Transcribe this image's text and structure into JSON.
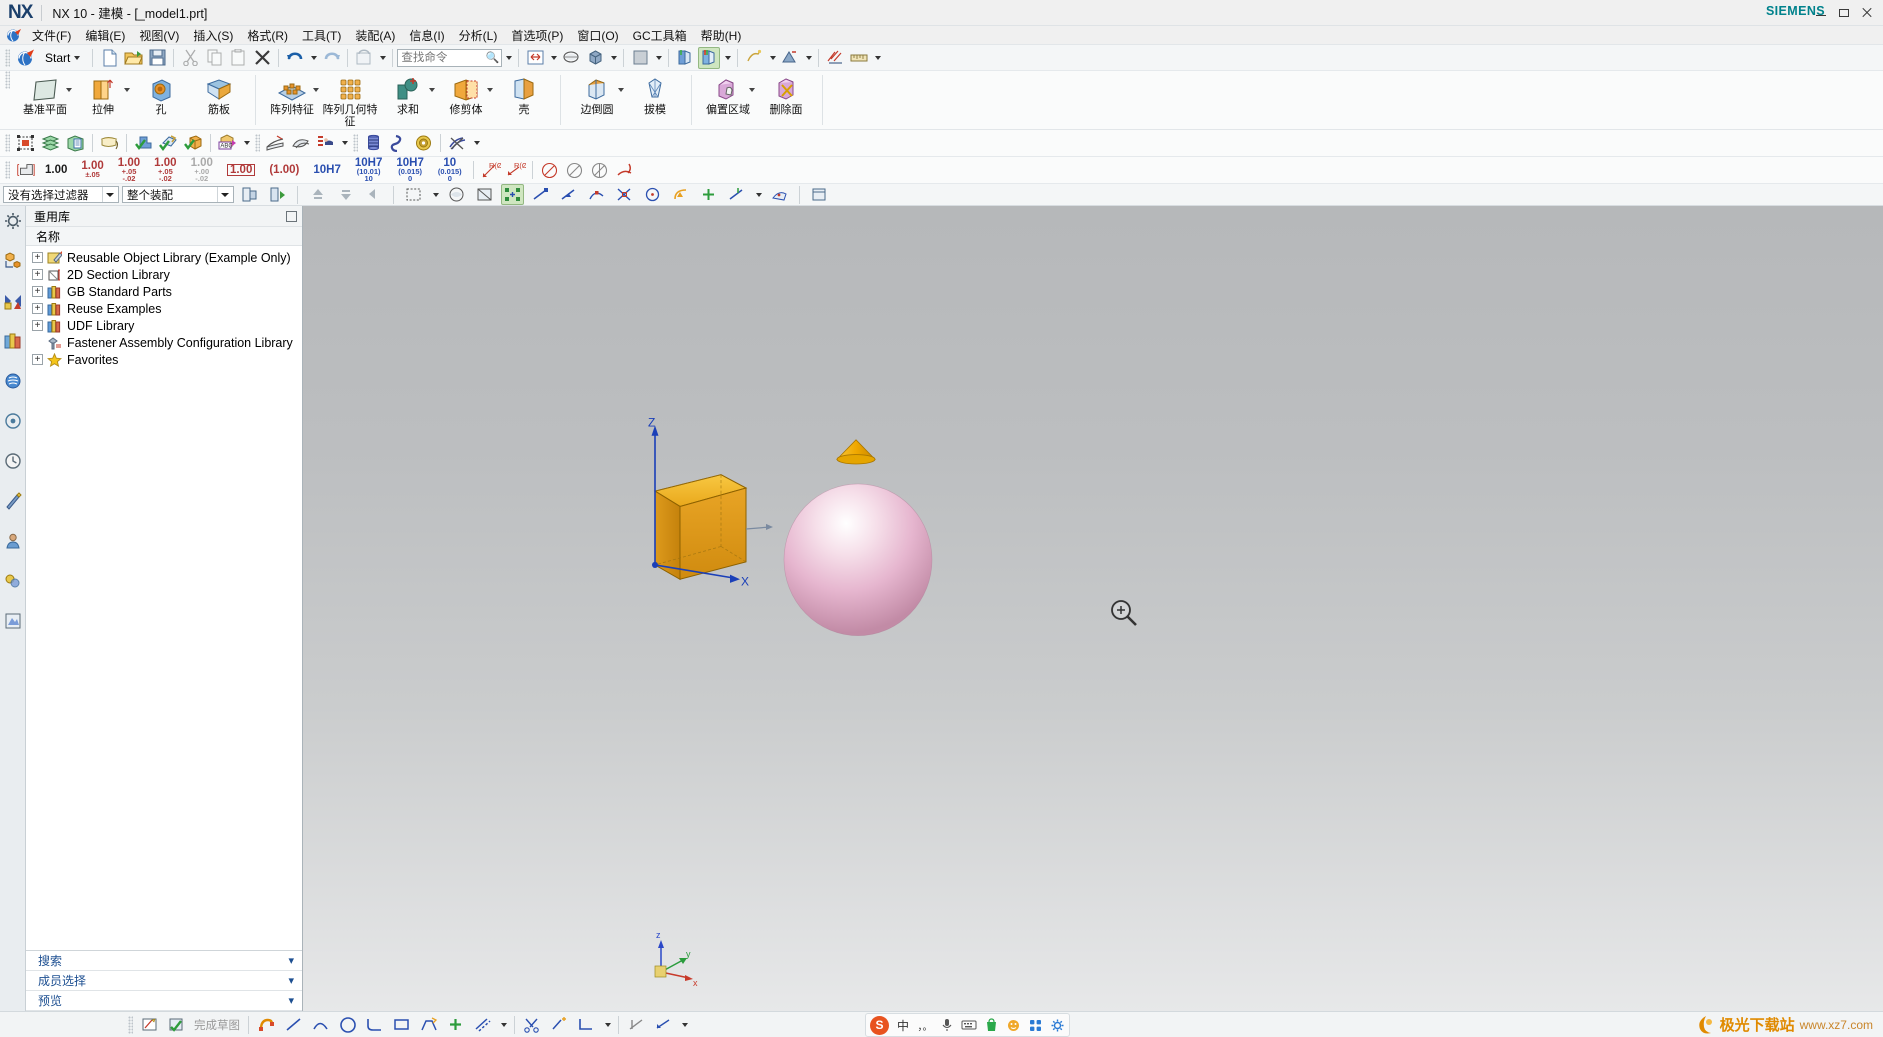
{
  "window": {
    "logo": "NX",
    "title": "NX 10 - 建模 - [_model1.prt]",
    "brand": "SIEMENS",
    "controls": {
      "minimize": "minimize-icon",
      "maximize": "maximize-icon",
      "close": "close-icon"
    }
  },
  "menubar": {
    "items": [
      {
        "label": "文件(F)",
        "name": "menu-file"
      },
      {
        "label": "编辑(E)",
        "name": "menu-edit"
      },
      {
        "label": "视图(V)",
        "name": "menu-view"
      },
      {
        "label": "插入(S)",
        "name": "menu-insert"
      },
      {
        "label": "格式(R)",
        "name": "menu-format"
      },
      {
        "label": "工具(T)",
        "name": "menu-tools"
      },
      {
        "label": "装配(A)",
        "name": "menu-assemblies"
      },
      {
        "label": "信息(I)",
        "name": "menu-information"
      },
      {
        "label": "分析(L)",
        "name": "menu-analysis"
      },
      {
        "label": "首选项(P)",
        "name": "menu-preferences"
      },
      {
        "label": "窗口(O)",
        "name": "menu-window"
      },
      {
        "label": "GC工具箱",
        "name": "menu-gc-toolkit"
      },
      {
        "label": "帮助(H)",
        "name": "menu-help"
      }
    ]
  },
  "quick_access": {
    "start_label": "Start",
    "search_placeholder": "查找命令",
    "search_value": "",
    "buttons": [
      {
        "name": "new-document-button",
        "icon": "new-file-icon"
      },
      {
        "name": "open-document-button",
        "icon": "open-folder-icon"
      },
      {
        "name": "save-button",
        "icon": "save-disk-icon"
      },
      {
        "name": "cut-button",
        "icon": "scissors-icon"
      },
      {
        "name": "copy-button",
        "icon": "copy-icon"
      },
      {
        "name": "paste-button",
        "icon": "clipboard-icon"
      },
      {
        "name": "delete-button",
        "icon": "x-delete-icon"
      },
      {
        "name": "undo-button",
        "icon": "undo-arrow-icon"
      },
      {
        "name": "redo-button",
        "icon": "redo-arrow-icon"
      },
      {
        "name": "refresh-button",
        "icon": "refresh-icon"
      },
      {
        "name": "fit-view-button",
        "icon": "fit-window-icon"
      },
      {
        "name": "zoom-button",
        "icon": "magnifier-icon"
      },
      {
        "name": "rotate-button",
        "icon": "rotate-cube-icon"
      },
      {
        "name": "style-button",
        "icon": "shaded-square-icon"
      },
      {
        "name": "render-style-button",
        "icon": "render-style-icon"
      },
      {
        "name": "orient-view-button",
        "icon": "orient-view-icon"
      },
      {
        "name": "layer-visible-button",
        "icon": "layers-icon"
      },
      {
        "name": "display-mode-button",
        "icon": "display-mode-icon"
      },
      {
        "name": "measure-button",
        "icon": "ruler-icon"
      }
    ]
  },
  "ribbon": {
    "groups": [
      {
        "name": "feature-group",
        "buttons": [
          {
            "label": "基准平面",
            "name": "datum-plane-button",
            "icon": "datum-plane-icon",
            "dropdown": true
          },
          {
            "label": "拉伸",
            "name": "extrude-button",
            "icon": "extrude-icon",
            "dropdown": true
          },
          {
            "label": "孔",
            "name": "hole-button",
            "icon": "hole-icon",
            "dropdown": false
          },
          {
            "label": "筋板",
            "name": "rib-button",
            "icon": "rib-icon",
            "dropdown": false
          }
        ]
      },
      {
        "name": "pattern-group",
        "buttons": [
          {
            "label": "阵列特征",
            "name": "pattern-feature-button",
            "icon": "pattern-feature-icon",
            "dropdown": true
          },
          {
            "label": "阵列几何特征",
            "name": "pattern-geometry-button",
            "icon": "pattern-geometry-icon",
            "dropdown": false
          },
          {
            "label": "求和",
            "name": "unite-button",
            "icon": "unite-icon",
            "dropdown": true
          },
          {
            "label": "修剪体",
            "name": "trim-body-button",
            "icon": "trim-body-icon",
            "dropdown": true
          },
          {
            "label": "壳",
            "name": "shell-button",
            "icon": "shell-icon",
            "dropdown": false
          }
        ]
      },
      {
        "name": "detail-group",
        "buttons": [
          {
            "label": "边倒圆",
            "name": "edge-blend-button",
            "icon": "edge-blend-icon",
            "dropdown": true
          },
          {
            "label": "拔模",
            "name": "draft-button",
            "icon": "draft-icon",
            "dropdown": false
          }
        ]
      },
      {
        "name": "surface-group",
        "buttons": [
          {
            "label": "偏置区域",
            "name": "offset-region-button",
            "icon": "offset-region-icon",
            "dropdown": true
          },
          {
            "label": "删除面",
            "name": "delete-face-button",
            "icon": "delete-face-icon",
            "dropdown": false
          }
        ]
      }
    ]
  },
  "toolbar_utility": {
    "buttons": [
      {
        "name": "move-object-button",
        "icon": "move-object-icon"
      },
      {
        "name": "layer-settings-button",
        "icon": "layer-stack-icon"
      },
      {
        "name": "layer-category-button",
        "icon": "layer-category-icon"
      },
      {
        "name": "note-button",
        "icon": "note-tag-icon"
      },
      {
        "name": "check-geometry-button",
        "icon": "check-solid-icon"
      },
      {
        "name": "check-sketch-button",
        "icon": "check-sketch-icon"
      },
      {
        "name": "check-body-button",
        "icon": "check-body-icon"
      },
      {
        "name": "annotation-button",
        "icon": "abc-annotation-icon"
      },
      {
        "name": "datum-feature-button",
        "icon": "datum-feature-icon"
      },
      {
        "name": "surface-feature-button",
        "icon": "surface-feature-icon"
      },
      {
        "name": "dimension-feature-button",
        "icon": "dimension-feature-icon"
      },
      {
        "name": "thread-button",
        "icon": "thread-coil-icon"
      },
      {
        "name": "spring-button",
        "icon": "spring-icon"
      },
      {
        "name": "gear-button",
        "icon": "gear-disc-icon"
      },
      {
        "name": "delete-thread-button",
        "icon": "delete-thread-icon"
      }
    ]
  },
  "toolbar_tolerance": {
    "buttons": [
      {
        "name": "dim-style-button",
        "icon": "dimension-style-icon"
      },
      {
        "main": "1.00",
        "sub": "",
        "color": "black",
        "name": "tolerance-none-button",
        "boxed": false,
        "paren": false
      },
      {
        "main": "1.00",
        "sub": "±.05",
        "color": "red",
        "name": "tolerance-bilateral-button",
        "boxed": false,
        "paren": false
      },
      {
        "main": "1.00",
        "sub": "+.05",
        "sub2": "-.02",
        "color": "red",
        "name": "tolerance-limit-button",
        "boxed": false,
        "paren": false
      },
      {
        "main": "1.00",
        "sub": "+.05",
        "sub2": "-.02",
        "color": "red",
        "name": "tolerance-limit2-button",
        "boxed": false,
        "paren": false
      },
      {
        "main": "1.00",
        "sub": "+.00",
        "sub2": "-.02",
        "color": "gray",
        "name": "tolerance-basic-button",
        "boxed": false,
        "paren": false
      },
      {
        "main": "1.00",
        "sub": "",
        "color": "red",
        "name": "tolerance-boxed-button",
        "boxed": true,
        "paren": false
      },
      {
        "main": "(1.00)",
        "sub": "",
        "color": "red",
        "name": "tolerance-reference-button",
        "boxed": false,
        "paren": true
      },
      {
        "main": "10H7",
        "sub": "",
        "color": "blue",
        "name": "fit-10h7-button",
        "boxed": false,
        "paren": false
      },
      {
        "main": "10H7",
        "sub": "(10.01)",
        "sub2": "10",
        "color": "blue",
        "name": "fit-10h7-value-button",
        "boxed": false,
        "paren": false
      },
      {
        "main": "10H7",
        "sub": "(0.015)",
        "sub2": "0",
        "color": "blue",
        "name": "fit-10h7-dev-button",
        "boxed": false,
        "paren": false
      },
      {
        "main": "10",
        "sub": "(0.015)",
        "sub2": "0",
        "color": "blue",
        "name": "fit-10-dev-button",
        "boxed": false,
        "paren": false
      }
    ],
    "extra_buttons": [
      {
        "name": "radius-dimension-button",
        "icon": "radius-dim-icon"
      },
      {
        "name": "diameter-dimension-button",
        "icon": "diameter-dim-icon"
      },
      {
        "name": "chamfer-dimension-button",
        "icon": "chamfer-dim-icon"
      },
      {
        "name": "angular-dimension-button",
        "icon": "angular-dim-icon"
      },
      {
        "name": "feature-control-button",
        "icon": "feature-control-icon"
      },
      {
        "name": "surface-finish-button",
        "icon": "surface-finish-icon"
      },
      {
        "name": "balloon-button",
        "icon": "balloon-icon"
      },
      {
        "name": "weld-symbol-button",
        "icon": "weld-symbol-icon"
      },
      {
        "name": "centerline-button",
        "icon": "centerline-icon"
      }
    ]
  },
  "selection_bar": {
    "filter": {
      "name": "selection-filter-combo",
      "value": "没有选择过滤器"
    },
    "scope": {
      "name": "selection-scope-combo",
      "value": "整个装配"
    },
    "buttons": [
      {
        "name": "select-whole-assembly-button",
        "icon": "assembly-select-icon"
      },
      {
        "name": "select-within-work-part-button",
        "icon": "work-part-select-icon"
      },
      {
        "name": "select-up-one-level-button",
        "icon": "up-level-icon"
      },
      {
        "name": "select-down-one-level-button",
        "icon": "down-level-icon"
      },
      {
        "name": "rectangle-select-button",
        "icon": "rectangle-select-icon"
      },
      {
        "name": "box-select-button",
        "icon": "box-select-icon"
      },
      {
        "name": "face-select-button",
        "icon": "face-select-icon"
      },
      {
        "name": "snap-point-button",
        "icon": "snap-point-icon"
      },
      {
        "name": "endpoint-snap-button",
        "icon": "endpoint-snap-icon"
      },
      {
        "name": "midpoint-snap-button",
        "icon": "midpoint-snap-icon"
      },
      {
        "name": "intersection-snap-button",
        "icon": "intersection-snap-icon"
      },
      {
        "name": "arc-center-snap-button",
        "icon": "arc-center-snap-icon"
      },
      {
        "name": "quadrant-snap-button",
        "icon": "quadrant-snap-icon"
      },
      {
        "name": "existing-point-snap-button",
        "icon": "existing-point-snap-icon"
      },
      {
        "name": "point-on-curve-snap-button",
        "icon": "point-on-curve-icon"
      },
      {
        "name": "point-on-face-snap-button",
        "icon": "point-on-face-icon"
      },
      {
        "name": "between-points-snap-button",
        "icon": "between-points-icon"
      }
    ]
  },
  "resource_bar": {
    "items": [
      {
        "name": "resource-assembly-navigator",
        "icon": "gear-node-icon"
      },
      {
        "name": "resource-constraint-navigator",
        "icon": "constraint-icon"
      },
      {
        "name": "resource-part-navigator",
        "icon": "part-navigator-icon"
      },
      {
        "name": "resource-reuse-library",
        "icon": "reuse-library-icon"
      },
      {
        "name": "resource-html-help",
        "icon": "html-help-icon"
      },
      {
        "name": "resource-web-browser",
        "icon": "web-browser-icon"
      },
      {
        "name": "resource-history",
        "icon": "history-clock-icon"
      },
      {
        "name": "resource-process-studio",
        "icon": "process-studio-icon"
      },
      {
        "name": "resource-role",
        "icon": "role-person-icon"
      },
      {
        "name": "resource-system-materials",
        "icon": "system-materials-icon"
      },
      {
        "name": "resource-system-scene",
        "icon": "system-scene-icon"
      }
    ]
  },
  "panel": {
    "title": "重用库",
    "pin": "pin-icon",
    "column_header": "名称",
    "tree": [
      {
        "label": "Reusable Object Library (Example Only)",
        "expandable": true,
        "icon": "reusable-object-library-icon",
        "name": "tree-item-reusable-object-library"
      },
      {
        "label": "2D Section Library",
        "expandable": true,
        "icon": "section-library-icon",
        "name": "tree-item-2d-section-library"
      },
      {
        "label": "GB Standard Parts",
        "expandable": true,
        "icon": "standard-parts-icon",
        "name": "tree-item-gb-standard-parts"
      },
      {
        "label": "Reuse Examples",
        "expandable": true,
        "icon": "standard-parts-icon",
        "name": "tree-item-reuse-examples"
      },
      {
        "label": "UDF Library",
        "expandable": true,
        "icon": "standard-parts-icon",
        "name": "tree-item-udf-library"
      },
      {
        "label": "Fastener Assembly Configuration Library",
        "expandable": false,
        "icon": "fastener-assembly-icon",
        "name": "tree-item-fastener-assembly"
      },
      {
        "label": "Favorites",
        "expandable": true,
        "icon": "favorites-star-icon",
        "name": "tree-item-favorites"
      }
    ],
    "sections": [
      {
        "label": "搜索",
        "name": "panel-section-search",
        "chevron": "▾"
      },
      {
        "label": "成员选择",
        "name": "panel-section-member-select",
        "chevron": "▾"
      },
      {
        "label": "预览",
        "name": "panel-section-preview",
        "chevron": "▾"
      }
    ]
  },
  "graphics": {
    "axes": {
      "z": "Z",
      "x": "X"
    },
    "triad_labels": {
      "z": "z",
      "y": "y",
      "x": "x"
    },
    "cursor": "zoom-magnifier-cursor",
    "objects": [
      {
        "name": "orange-block-body",
        "type": "block"
      },
      {
        "name": "pink-sphere-body",
        "type": "sphere"
      },
      {
        "name": "yellow-cone-body",
        "type": "cone"
      }
    ]
  },
  "bottom_bar": {
    "buttons": [
      {
        "name": "sketch-in-task-button",
        "icon": "sketch-task-icon"
      },
      {
        "name": "finish-sketch-button",
        "icon": "finish-sketch-icon",
        "label": "完成草图"
      },
      {
        "name": "sketch-constraint-button",
        "icon": "constraint-magnet-icon"
      },
      {
        "name": "line-button",
        "icon": "line-icon"
      },
      {
        "name": "arc-button",
        "icon": "arc-icon"
      },
      {
        "name": "circle-button",
        "icon": "circle-icon"
      },
      {
        "name": "fillet-button",
        "icon": "fillet-icon"
      },
      {
        "name": "rectangle-button",
        "icon": "rectangle-icon"
      },
      {
        "name": "profile-button",
        "icon": "profile-icon"
      },
      {
        "name": "point-button",
        "icon": "point-plus-icon"
      },
      {
        "name": "derived-line-button",
        "icon": "derived-line-icon"
      },
      {
        "name": "quick-trim-button",
        "icon": "quick-trim-icon"
      },
      {
        "name": "quick-extend-button",
        "icon": "quick-extend-icon"
      },
      {
        "name": "make-corner-button",
        "icon": "make-corner-icon"
      },
      {
        "name": "geometric-constraint-button",
        "icon": "geometric-constraint-icon"
      },
      {
        "name": "auto-dimension-button",
        "icon": "auto-dimension-icon"
      }
    ],
    "finish_sketch_label": "完成草图"
  },
  "ime": {
    "logo": "S",
    "items": [
      {
        "label": "中",
        "name": "ime-chinese-mode",
        "icon": "chinese-mode-icon"
      },
      {
        "label": "，。",
        "name": "ime-punctuation-mode",
        "icon": "punctuation-icon"
      },
      {
        "label": "",
        "name": "ime-voice-input",
        "icon": "microphone-icon"
      },
      {
        "label": "",
        "name": "ime-soft-keyboard",
        "icon": "keyboard-icon"
      },
      {
        "label": "",
        "name": "ime-shopping",
        "icon": "shopping-bag-icon"
      },
      {
        "label": "",
        "name": "ime-emoji",
        "icon": "emoji-icon"
      },
      {
        "label": "",
        "name": "ime-app-grid",
        "icon": "app-grid-icon"
      },
      {
        "label": "",
        "name": "ime-settings",
        "icon": "settings-gear-icon"
      }
    ]
  },
  "watermark": {
    "text": "极光下载站",
    "url": "www.xz7.com"
  },
  "colors": {
    "accent": "#1d4f91",
    "brand": "#00828c",
    "block_orange": "#e59a12",
    "sphere_pink": "#e5b8ce",
    "cone_yellow": "#f0b800",
    "axis_blue": "#1a3fb8",
    "tolerance_blue": "#2a4fb0",
    "tolerance_red": "#b03a3a",
    "watermark_orange": "#e08a00"
  }
}
